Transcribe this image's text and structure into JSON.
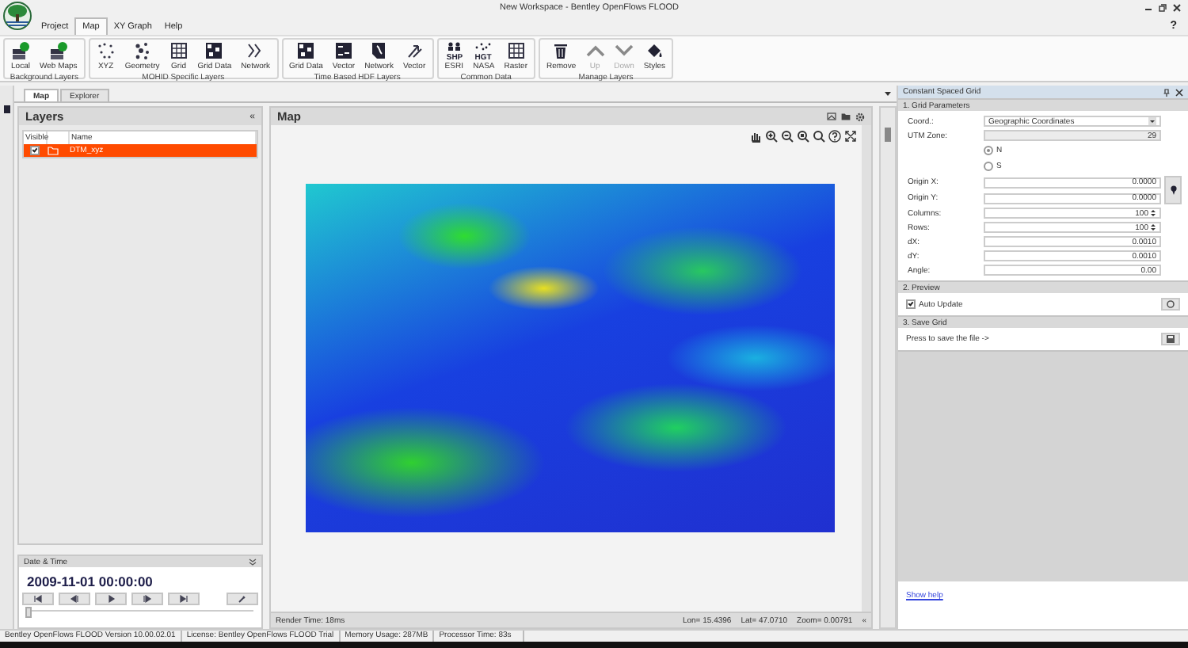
{
  "window": {
    "title": "New Workspace - Bentley OpenFlows FLOOD"
  },
  "menu": [
    {
      "label": "Project",
      "selected": false
    },
    {
      "label": "Map",
      "selected": true
    },
    {
      "label": "XY Graph",
      "selected": false
    },
    {
      "label": "Help",
      "selected": false
    }
  ],
  "help_button": "?",
  "ribbon": [
    {
      "label": "Background Layers",
      "buttons": [
        {
          "label": "Local",
          "kind": "server",
          "disabled": false
        },
        {
          "label": "Web Maps",
          "kind": "server",
          "disabled": false
        }
      ]
    },
    {
      "label": "MOHID Specific Layers",
      "buttons": [
        {
          "label": "XYZ",
          "kind": "dots",
          "disabled": false
        },
        {
          "label": "Geometry",
          "kind": "scatter",
          "disabled": false
        },
        {
          "label": "Grid",
          "kind": "grid",
          "disabled": false
        },
        {
          "label": "Grid Data",
          "kind": "tiles",
          "disabled": false
        },
        {
          "label": "Network",
          "kind": "chevrons",
          "disabled": false
        }
      ]
    },
    {
      "label": "Time Based HDF Layers",
      "buttons": [
        {
          "label": "Grid Data",
          "kind": "tiles",
          "disabled": false
        },
        {
          "label": "Vector",
          "kind": "grid-arrows",
          "disabled": false
        },
        {
          "label": "Network",
          "kind": "map-shape",
          "disabled": false
        },
        {
          "label": "Vector",
          "kind": "arrows",
          "disabled": false
        }
      ]
    },
    {
      "label": "Common Data",
      "buttons": [
        {
          "label": "ESRI",
          "kind": "shp",
          "icon_text": "SHP",
          "disabled": false
        },
        {
          "label": "NASA",
          "kind": "hgt",
          "icon_text": "HGT",
          "disabled": false
        },
        {
          "label": "Raster",
          "kind": "grid",
          "disabled": false
        }
      ]
    },
    {
      "label": "Manage Layers",
      "buttons": [
        {
          "label": "Remove",
          "kind": "trash",
          "disabled": false
        },
        {
          "label": "Up",
          "kind": "up",
          "disabled": true
        },
        {
          "label": "Down",
          "kind": "down",
          "disabled": true
        },
        {
          "label": "Styles",
          "kind": "styles",
          "disabled": false
        }
      ]
    }
  ],
  "doc_tabs": [
    {
      "label": "Map",
      "selected": true
    },
    {
      "label": "Explorer",
      "selected": false
    }
  ],
  "layers": {
    "title": "Layers",
    "collapse": "«",
    "columns": {
      "visible": "Visible",
      "name": "Name"
    },
    "rows": [
      {
        "visible": true,
        "name": "DTM_xyz",
        "selected": true
      }
    ]
  },
  "date_time": {
    "title": "Date & Time",
    "value": "2009-11-01 00:00:00",
    "level": 0
  },
  "map": {
    "title": "Map",
    "render_time": "Render Time: 18ms",
    "lon": "Lon= 15.4396",
    "lat": "Lat= 47.0710",
    "zoom": "Zoom= 0.00791",
    "collapse": "«"
  },
  "grid_panel": {
    "title": "Constant Spaced Grid",
    "parameters": {
      "title": "1. Grid Parameters",
      "fields": [
        {
          "kind": "select",
          "label": "Coord.:",
          "value": "Geographic Coordinates"
        },
        {
          "kind": "readonly",
          "label": "UTM Zone:",
          "value": "29"
        },
        {
          "kind": "radio",
          "label": "N",
          "selected": true
        },
        {
          "kind": "radio",
          "label": "S",
          "selected": false
        },
        {
          "kind": "text",
          "label": "Origin X:",
          "value": "0.0000"
        },
        {
          "kind": "text",
          "label": "Origin Y:",
          "value": "0.0000"
        },
        {
          "kind": "spin",
          "label": "Columns:",
          "value": "100"
        },
        {
          "kind": "spin",
          "label": "Rows:",
          "value": "100"
        },
        {
          "kind": "text",
          "label": "dX:",
          "value": "0.0010"
        },
        {
          "kind": "text",
          "label": "dY:",
          "value": "0.0010"
        },
        {
          "kind": "text",
          "label": "Angle:",
          "value": "0.00"
        }
      ]
    },
    "preview": {
      "title": "2. Preview",
      "label": "Auto Update",
      "checked": true
    },
    "save": {
      "title": "3. Save Grid",
      "text": "Press to save the file ->"
    },
    "help_link": "Show help"
  },
  "status_bar": [
    "Bentley OpenFlows FLOOD Version 10.00.02.01",
    "License: Bentley OpenFlows FLOOD Trial",
    "Memory Usage: 287MB",
    "Processor Time: 83s"
  ]
}
